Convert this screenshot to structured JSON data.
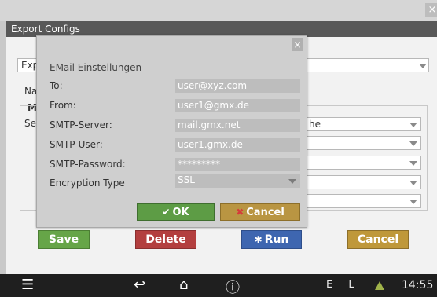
{
  "window": {
    "title": "Export Configs",
    "close": "×"
  },
  "background": {
    "export_select": "Exp",
    "name_label": "Na",
    "m_label": "M",
    "se_label": "Se",
    "select_suffix": "he"
  },
  "buttons": {
    "save": "Save",
    "delete": "Delete",
    "run": "Run",
    "cancel": "Cancel"
  },
  "dialog": {
    "close": "×",
    "title": "EMail Einstellungen",
    "fields": [
      {
        "label": "To:",
        "value": "user@xyz.com"
      },
      {
        "label": "From:",
        "value": "user1@gmx.de"
      },
      {
        "label": "SMTP-Server:",
        "value": "mail.gmx.net"
      },
      {
        "label": "SMTP-User:",
        "value": "user1.gmx.de"
      },
      {
        "label": "SMTP-Password:",
        "value": "*********"
      }
    ],
    "encryption": {
      "label": "Encryption Type",
      "value": "SSL"
    },
    "ok": "OK",
    "cancel": "Cancel"
  },
  "taskbar": {
    "lang": "E L",
    "time": "14:55"
  },
  "icons": [
    "menu-icon",
    "back-icon",
    "home-icon",
    "info-icon",
    "warning-icon",
    "check-icon",
    "x-icon",
    "gear-icon",
    "chevron-down-icon",
    "close-icon"
  ],
  "colors": {
    "save": "#66a548",
    "delete": "#b33f3f",
    "run": "#3e66b0",
    "cancel": "#bf983a",
    "titlebar": "#585858"
  }
}
